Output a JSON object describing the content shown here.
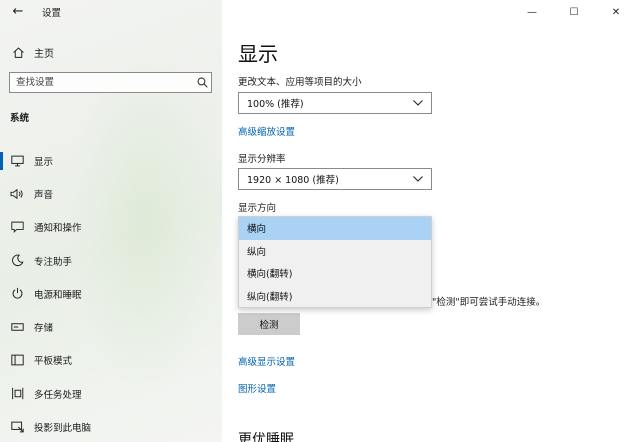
{
  "window": {
    "title": "设置",
    "back_glyph": "←",
    "controls": {
      "minimize": "—",
      "maximize": "☐",
      "close": "✕"
    }
  },
  "sidebar": {
    "home_label": "主页",
    "search_placeholder": "查找设置",
    "section_title": "系统",
    "items": [
      {
        "label": "显示",
        "icon": "monitor-icon",
        "active": true
      },
      {
        "label": "声音",
        "icon": "speaker-icon"
      },
      {
        "label": "通知和操作",
        "icon": "notification-icon"
      },
      {
        "label": "专注助手",
        "icon": "moon-icon"
      },
      {
        "label": "电源和睡眠",
        "icon": "power-icon"
      },
      {
        "label": "存储",
        "icon": "storage-icon"
      },
      {
        "label": "平板模式",
        "icon": "tablet-icon"
      },
      {
        "label": "多任务处理",
        "icon": "multitask-icon"
      },
      {
        "label": "投影到此电脑",
        "icon": "project-icon"
      }
    ]
  },
  "main": {
    "title": "显示",
    "scale_label": "更改文本、应用等项目的大小",
    "scale_value": "100% (推荐)",
    "advanced_scaling_link": "高级缩放设置",
    "resolution_label": "显示分辨率",
    "resolution_value": "1920 × 1080 (推荐)",
    "orientation_label": "显示方向",
    "orientation_options": [
      "横向",
      "纵向",
      "横向(翻转)",
      "纵向(翻转)"
    ],
    "orientation_selected_index": 0,
    "detect_hint_partial": "\"检测\"即可尝试手动连接。",
    "detect_button": "检测",
    "advanced_display_link": "高级显示设置",
    "graphics_link": "图形设置",
    "next_heading_cut": "更优睡眠"
  },
  "colors": {
    "accent": "#0063b1",
    "selected_option": "#a9d2f5",
    "button_bg": "#cccccc"
  }
}
